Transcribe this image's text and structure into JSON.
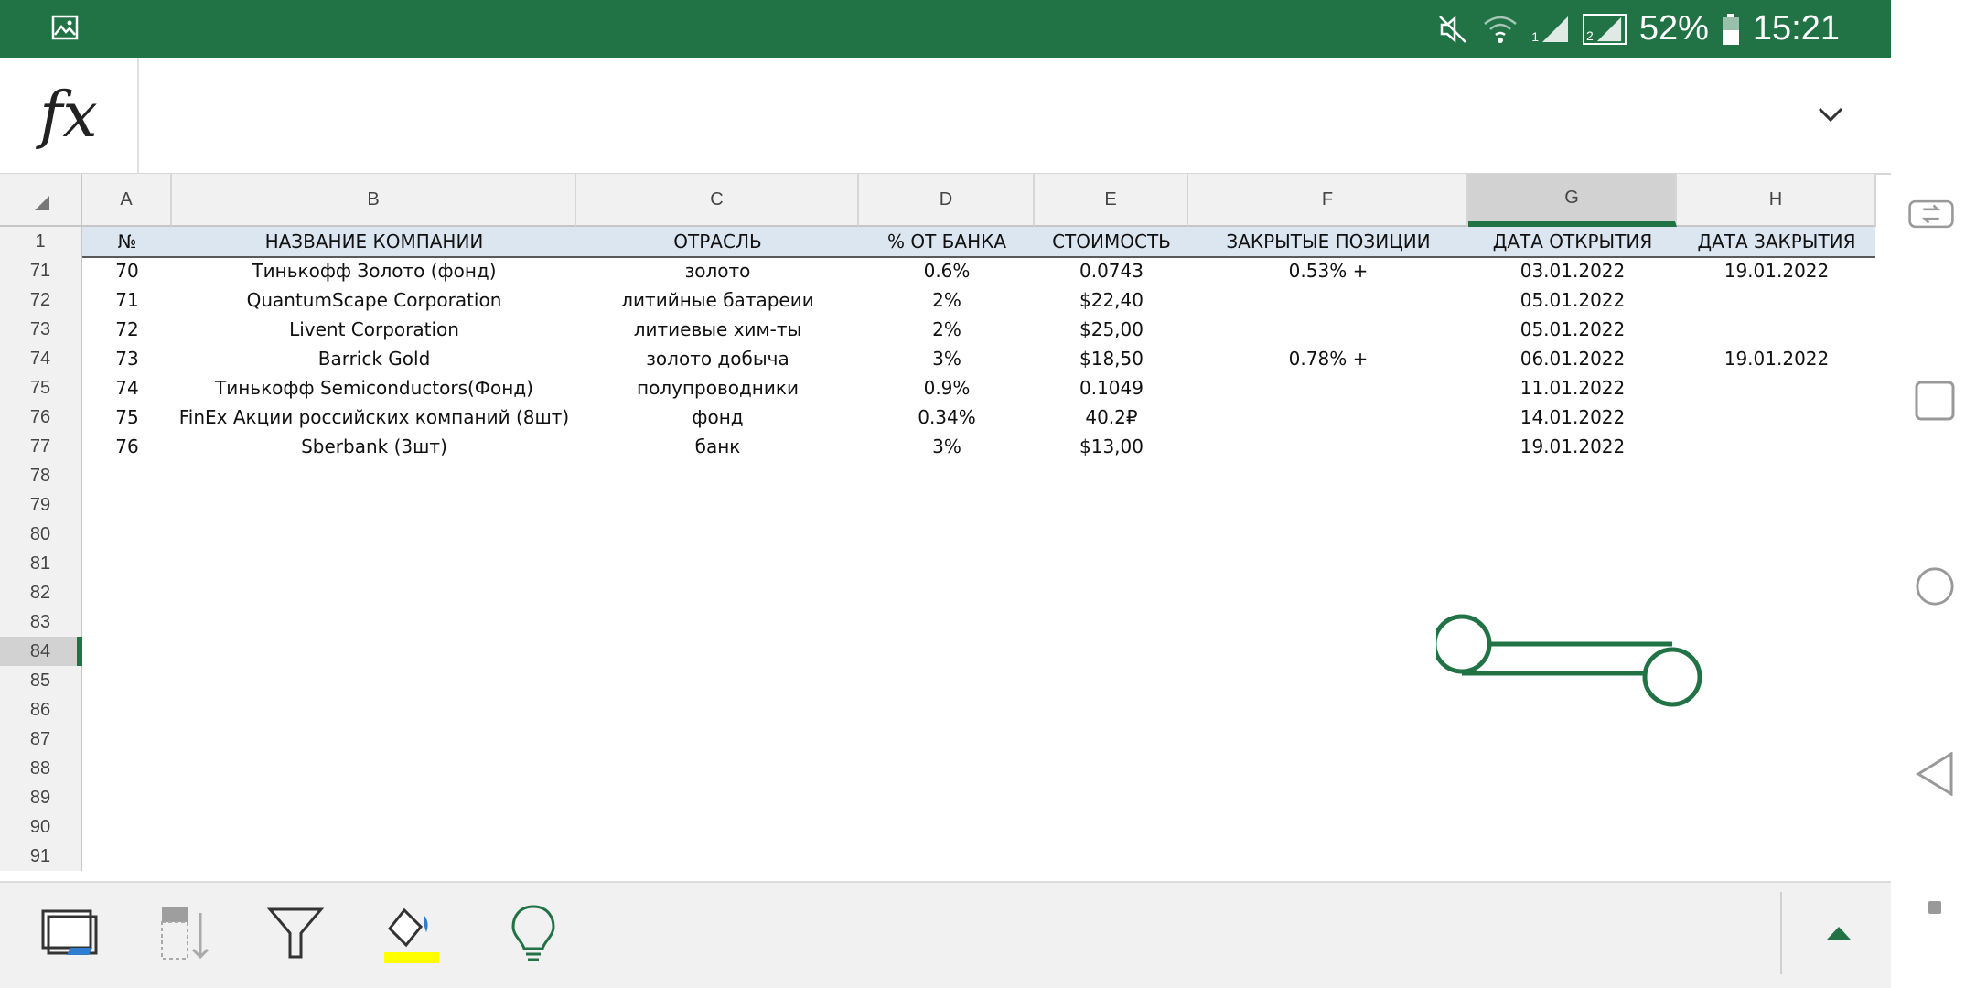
{
  "status": {
    "battery": "52%",
    "time": "15:21",
    "sim1": "1",
    "sim2": "2"
  },
  "formula_bar": {
    "fx_label": "fx",
    "value": ""
  },
  "columns": [
    {
      "letter": "A",
      "width": 98
    },
    {
      "letter": "B",
      "width": 442
    },
    {
      "letter": "C",
      "width": 309
    },
    {
      "letter": "D",
      "width": 192
    },
    {
      "letter": "E",
      "width": 168
    },
    {
      "letter": "F",
      "width": 306
    },
    {
      "letter": "G",
      "width": 228
    },
    {
      "letter": "H",
      "width": 218
    }
  ],
  "selected_column": "G",
  "header_row": {
    "number": "1",
    "cells": [
      "№",
      "НАЗВАНИЕ КОМПАНИИ",
      "ОТРАСЛЬ",
      "% ОТ БАНКА",
      "СТОИМОСТЬ",
      "ЗАКРЫТЫЕ ПОЗИЦИИ",
      "ДАТА ОТКРЫТИЯ",
      "ДАТА ЗАКРЫТИЯ"
    ]
  },
  "rows": [
    {
      "number": "71",
      "cells": [
        "70",
        "Тинькофф Золото (фонд)",
        "золото",
        "0.6%",
        "0.0743",
        "0.53% +",
        "03.01.2022",
        "19.01.2022"
      ]
    },
    {
      "number": "72",
      "cells": [
        "71",
        "QuantumScape Corporation",
        "литийные батареии",
        "2%",
        "$22,40",
        "",
        "05.01.2022",
        ""
      ]
    },
    {
      "number": "73",
      "cells": [
        "72",
        "Livent Corporation",
        "литиевые хим-ты",
        "2%",
        "$25,00",
        "",
        "05.01.2022",
        ""
      ]
    },
    {
      "number": "74",
      "cells": [
        "73",
        "Barrick Gold",
        "золото добыча",
        "3%",
        "$18,50",
        "0.78% +",
        "06.01.2022",
        "19.01.2022"
      ]
    },
    {
      "number": "75",
      "cells": [
        "74",
        "Тинькофф Semiconductors(Фонд)",
        "полупроводники",
        "0.9%",
        "0.1049",
        "",
        "11.01.2022",
        ""
      ]
    },
    {
      "number": "76",
      "cells": [
        "75",
        "FinEx Акции российских компаний (8шт)",
        "фонд",
        "0.34%",
        "40.2₽",
        "",
        "14.01.2022",
        ""
      ]
    },
    {
      "number": "77",
      "cells": [
        "76",
        "Sberbank (3шт)",
        "банк",
        "3%",
        "$13,00",
        "",
        "19.01.2022",
        ""
      ]
    },
    {
      "number": "78",
      "cells": []
    },
    {
      "number": "79",
      "cells": []
    },
    {
      "number": "80",
      "cells": []
    },
    {
      "number": "81",
      "cells": []
    },
    {
      "number": "82",
      "cells": []
    },
    {
      "number": "83",
      "cells": []
    },
    {
      "number": "84",
      "cells": [],
      "selected": true
    },
    {
      "number": "85",
      "cells": []
    },
    {
      "number": "86",
      "cells": []
    },
    {
      "number": "87",
      "cells": []
    },
    {
      "number": "88",
      "cells": []
    },
    {
      "number": "89",
      "cells": []
    },
    {
      "number": "90",
      "cells": []
    },
    {
      "number": "91",
      "cells": []
    }
  ],
  "toolbar": {
    "items": [
      "select-sheet-icon",
      "sort-icon",
      "filter-icon",
      "fill-color-icon",
      "ideas-icon",
      "expand-up-icon"
    ]
  },
  "colors": {
    "accent": "#217346",
    "header_fill": "#dce6f1",
    "fill_highlight": "#ffff00"
  }
}
